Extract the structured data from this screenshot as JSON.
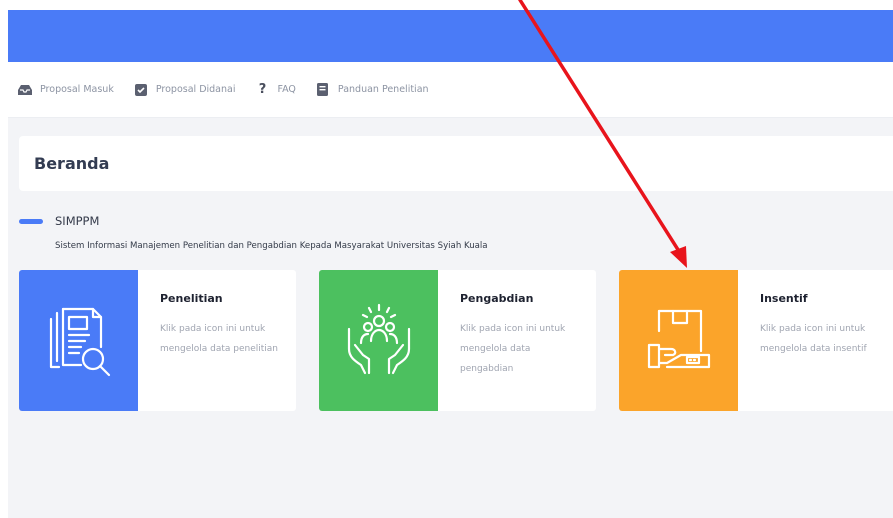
{
  "nav": {
    "items": [
      {
        "label": "Proposal Masuk",
        "icon": "inbox-icon"
      },
      {
        "label": "Proposal Didanai",
        "icon": "checkbox-icon"
      },
      {
        "label": "FAQ",
        "icon": "question-icon"
      },
      {
        "label": "Panduan Penelitian",
        "icon": "book-icon"
      }
    ]
  },
  "page": {
    "title": "Beranda"
  },
  "section": {
    "title": "SIMPPM",
    "description": "Sistem Informasi Manajemen Penelitian dan Pengabdian Kepada Masyarakat Universitas Syiah Kuala"
  },
  "cards": [
    {
      "title": "Penelitian",
      "desc": "Klik pada icon ini untuk mengelola data penelitian",
      "color": "#4a7bf7",
      "icon": "research-document-icon"
    },
    {
      "title": "Pengabdian",
      "desc": "Klik pada icon ini untuk mengelola data pengabdian",
      "color": "#4cc05f",
      "icon": "community-hands-icon"
    },
    {
      "title": "Insentif",
      "desc": "Klik pada icon ini untuk mengelola data insentif",
      "color": "#fba42a",
      "icon": "package-hand-icon"
    }
  ],
  "colors": {
    "topbar": "#4a7bf7",
    "annotation_arrow": "#e8141c"
  }
}
